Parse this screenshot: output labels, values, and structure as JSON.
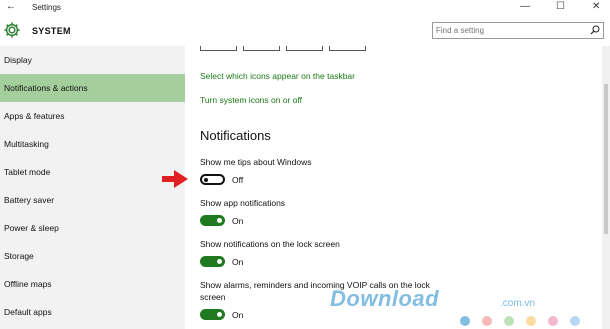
{
  "window": {
    "title": "Settings",
    "back_glyph": "←",
    "minimize_glyph": "—",
    "maximize_glyph": "☐",
    "close_glyph": "✕"
  },
  "header": {
    "title": "SYSTEM",
    "icon": "gear-icon",
    "accent": "#2e7d32"
  },
  "search": {
    "placeholder": "Find a setting",
    "icon": "search-icon"
  },
  "sidebar": {
    "items": [
      {
        "label": "Display"
      },
      {
        "label": "Notifications & actions",
        "active": true
      },
      {
        "label": "Apps & features"
      },
      {
        "label": "Multitasking"
      },
      {
        "label": "Tablet mode"
      },
      {
        "label": "Battery saver"
      },
      {
        "label": "Power & sleep"
      },
      {
        "label": "Storage"
      },
      {
        "label": "Offline maps"
      },
      {
        "label": "Default apps"
      }
    ],
    "active_color": "#a4cf9c"
  },
  "main": {
    "links": {
      "taskbar_icons": "Select which icons appear on the taskbar",
      "system_icons": "Turn system icons on or off"
    },
    "section_title": "Notifications",
    "settings": [
      {
        "label": "Show me tips about Windows",
        "state": "Off",
        "on": false
      },
      {
        "label": "Show app notifications",
        "state": "On",
        "on": true
      },
      {
        "label": "Show notifications on the lock screen",
        "state": "On",
        "on": true
      },
      {
        "label": "Show alarms, reminders and incoming VOIP calls on the lock screen",
        "state": "On",
        "on": true
      }
    ],
    "toggle_on_color": "#1f7a1f",
    "link_color": "#1a7b17"
  },
  "annotation": {
    "arrow_color": "#e02020"
  },
  "watermark": {
    "text": "Download",
    "suffix": ".com.vn",
    "dot_colors": [
      "#5aa8d8",
      "#f4a3a3",
      "#a8d8a0",
      "#f8d080",
      "#f0a0c0",
      "#a0c8f0"
    ]
  }
}
